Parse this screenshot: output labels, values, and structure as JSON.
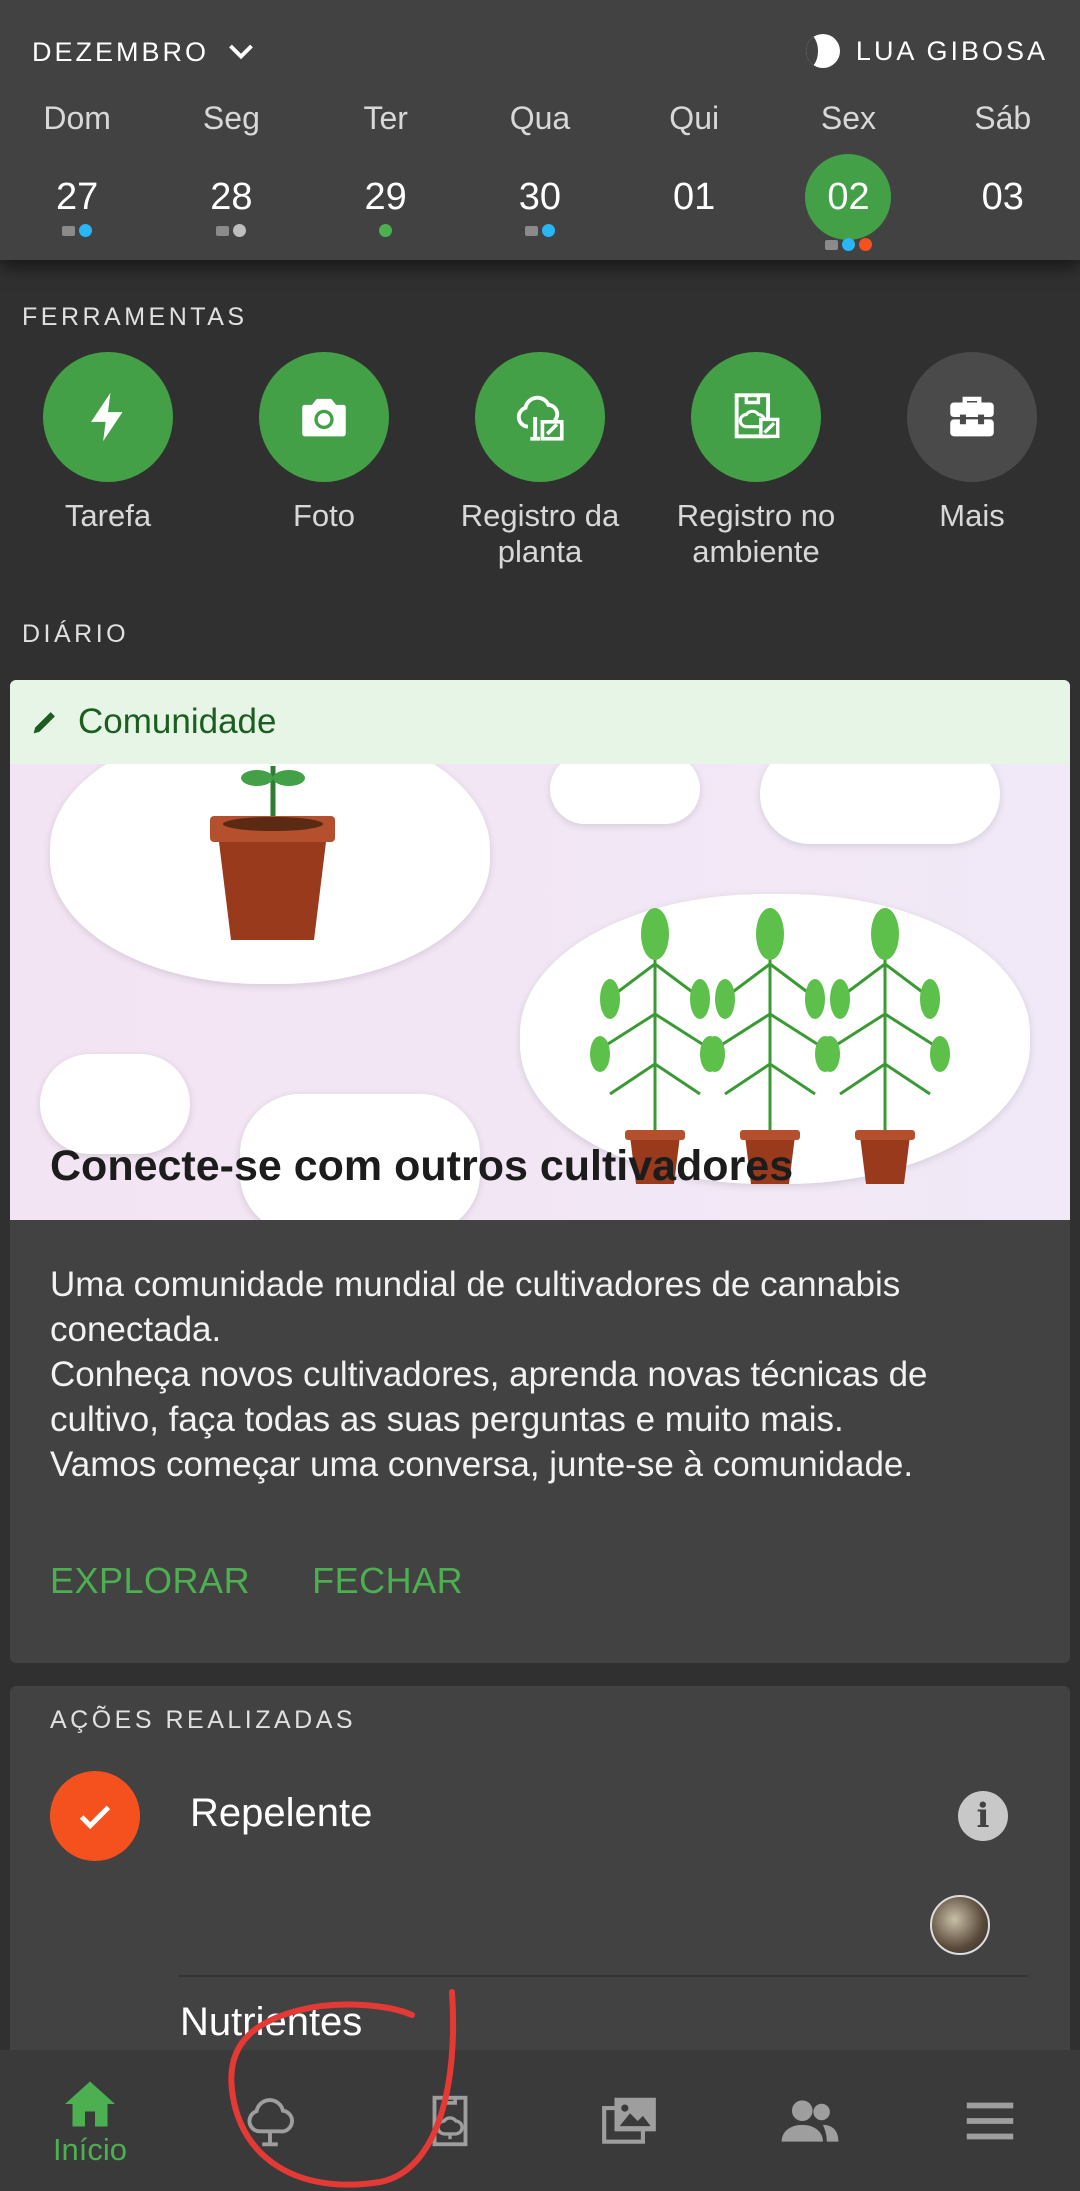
{
  "calendar": {
    "month": "DEZEMBRO",
    "moon_phase": "LUA GIBOSA",
    "days": [
      {
        "dow": "Dom",
        "num": "27",
        "marks": [
          "cam",
          "#29b6f6"
        ]
      },
      {
        "dow": "Seg",
        "num": "28",
        "marks": [
          "cam",
          "#bdbdbd"
        ]
      },
      {
        "dow": "Ter",
        "num": "29",
        "marks": [
          "#4caf50"
        ]
      },
      {
        "dow": "Qua",
        "num": "30",
        "marks": [
          "cam",
          "#29b6f6"
        ]
      },
      {
        "dow": "Qui",
        "num": "01",
        "marks": []
      },
      {
        "dow": "Sex",
        "num": "02",
        "marks": [
          "cam",
          "#29b6f6",
          "#f4511e"
        ],
        "selected": true
      },
      {
        "dow": "Sáb",
        "num": "03",
        "marks": []
      }
    ]
  },
  "tools": {
    "title": "FERRAMENTAS",
    "items": [
      {
        "label": "Tarefa",
        "icon": "bolt-icon"
      },
      {
        "label": "Foto",
        "icon": "camera-icon"
      },
      {
        "label": "Registro da planta",
        "icon": "plant-log-icon"
      },
      {
        "label": "Registro no ambiente",
        "icon": "environment-log-icon"
      },
      {
        "label": "Mais",
        "icon": "toolbox-icon"
      }
    ]
  },
  "diary": {
    "title": "DIÁRIO",
    "community": {
      "header": "Comunidade",
      "hero_title": "Conecte-se com outros cultivadores",
      "body": [
        "Uma comunidade mundial de cultivadores de cannabis conectada.",
        "Conheça novos cultivadores, aprenda novas técnicas de cultivo, faça todas as suas perguntas e muito mais.",
        "Vamos começar uma conversa, junte-se à comunidade."
      ],
      "explore_label": "EXPLORAR",
      "close_label": "FECHAR"
    }
  },
  "actions": {
    "title": "AÇÕES REALIZADAS",
    "items": [
      "Repelente",
      "Nutrientes"
    ]
  },
  "nav": {
    "home_label": "Início",
    "icons": [
      "home-icon",
      "tree-icon",
      "environment-icon",
      "gallery-icon",
      "community-icon",
      "menu-icon"
    ]
  },
  "colors": {
    "accent": "#43a047",
    "action_done": "#f4511e",
    "header_bg": "#424242",
    "page_bg": "#303030",
    "annotation": "#e53935"
  }
}
